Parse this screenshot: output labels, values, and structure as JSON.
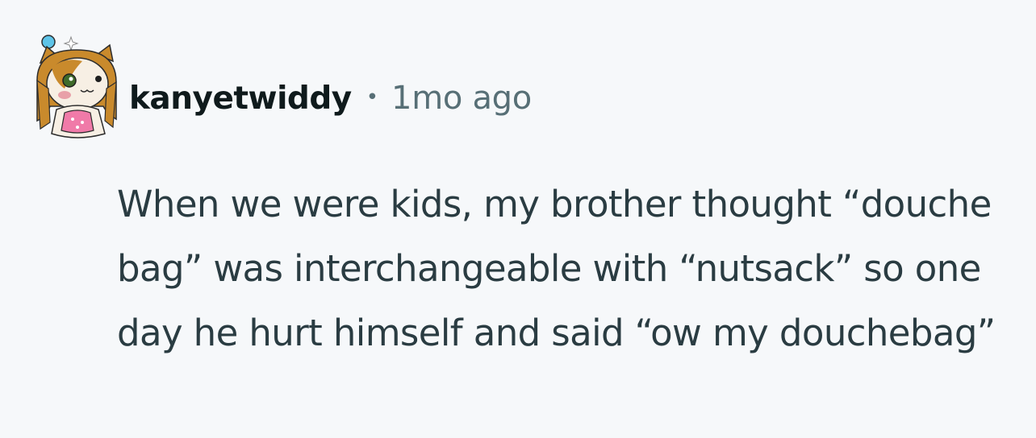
{
  "comment": {
    "username": "kanyetwiddy",
    "separator": "•",
    "timestamp": "1mo ago",
    "body": "When we were kids, my brother thought “douche bag” was interchangeable with “nutsack” so one day he hurt himself and said “ow my douchebag”"
  },
  "avatar": {
    "icon": "snoo-avatar-icon",
    "colors": {
      "hair": "#c98a2c",
      "skin": "#f7efe4",
      "outfit": "#f07aa8",
      "eye": "#3f6b2a",
      "accessory": "#5ec4e8"
    }
  },
  "colors": {
    "background": "#f6f8fa",
    "username": "#0f1a1c",
    "meta": "#576f76",
    "body": "#2a3c42"
  }
}
